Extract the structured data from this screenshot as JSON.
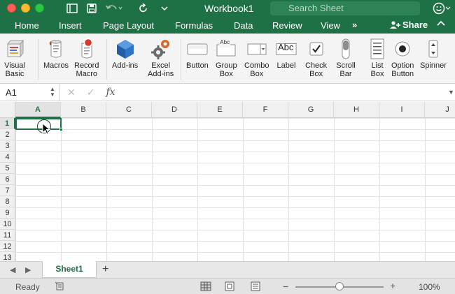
{
  "window": {
    "title": "Workbook1",
    "search_placeholder": "Search Sheet"
  },
  "colors": {
    "accent": "#1e7145"
  },
  "tabs": [
    "Home",
    "Insert",
    "Page Layout",
    "Formulas",
    "Data",
    "Review",
    "View"
  ],
  "more_tabs": "»",
  "share_label": "Share",
  "ribbon": {
    "items": [
      {
        "label": "Visual\nBasic",
        "icon": "visual-basic-icon"
      },
      {
        "label": "Macros",
        "icon": "macros-icon"
      },
      {
        "label": "Record\nMacro",
        "icon": "record-macro-icon"
      },
      {
        "label": "Add-ins",
        "icon": "add-ins-icon"
      },
      {
        "label": "Excel\nAdd-ins",
        "icon": "excel-add-ins-icon"
      },
      {
        "label": "Button",
        "icon": "button-control-icon"
      },
      {
        "label": "Group\nBox",
        "icon": "group-box-icon"
      },
      {
        "label": "Combo\nBox",
        "icon": "combo-box-icon"
      },
      {
        "label": "Label",
        "icon": "label-control-icon"
      },
      {
        "label": "Check\nBox",
        "icon": "check-box-icon"
      },
      {
        "label": "Scroll\nBar",
        "icon": "scroll-bar-icon"
      },
      {
        "label": "List\nBox",
        "icon": "list-box-icon"
      },
      {
        "label": "Option\nButton",
        "icon": "option-button-icon"
      },
      {
        "label": "Spinner",
        "icon": "spinner-icon"
      }
    ],
    "group_box_text": "Abc",
    "label_text": "Abc"
  },
  "formula_bar": {
    "name_box": "A1",
    "fx": "fx",
    "value": ""
  },
  "grid": {
    "columns": [
      "A",
      "B",
      "C",
      "D",
      "E",
      "F",
      "G",
      "H",
      "I",
      "J"
    ],
    "rows": [
      "1",
      "2",
      "3",
      "4",
      "5",
      "6",
      "7",
      "8",
      "9",
      "10",
      "11",
      "12",
      "13"
    ],
    "selected_cell": "A1"
  },
  "sheets": [
    "Sheet1"
  ],
  "add_sheet": "+",
  "status": {
    "text": "Ready",
    "zoom_minus": "−",
    "zoom_plus": "+",
    "zoom": "100%",
    "zoom_fraction": 0.5
  }
}
